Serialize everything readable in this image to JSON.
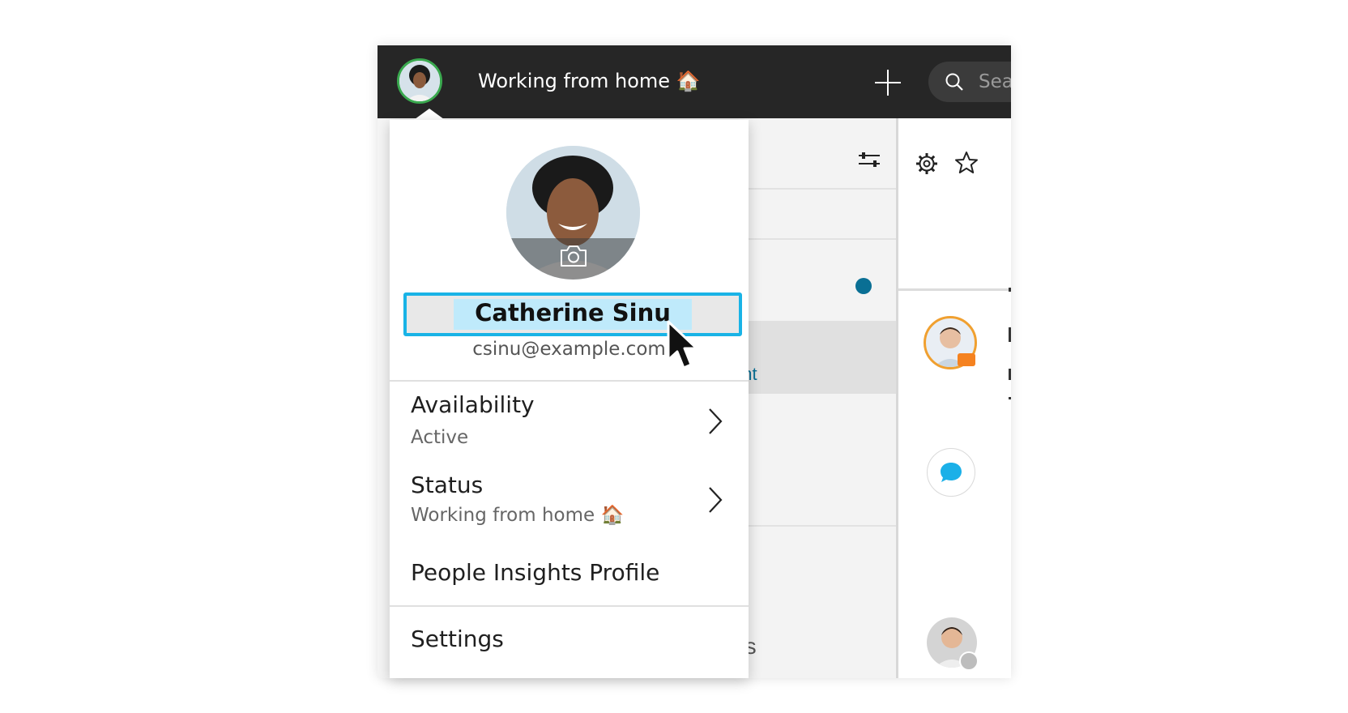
{
  "header": {
    "status_text": "Working from home 🏠",
    "search_placeholder": "Sea"
  },
  "profile": {
    "name": "Catherine Sinu",
    "email": "csinu@example.com"
  },
  "menu": {
    "availability": {
      "label": "Availability",
      "value": "Active"
    },
    "status": {
      "label": "Status",
      "value": "Working from home 🏠"
    },
    "people_insights": "People Insights Profile",
    "settings": "Settings"
  },
  "background": {
    "selected_fragment": "ent",
    "lower_fragment": "ds"
  },
  "icons": [
    "avatar",
    "plus-icon",
    "search-icon",
    "sliders-icon",
    "gear-icon",
    "star-icon",
    "camera-icon",
    "chevron-right-icon",
    "video-icon",
    "chat-icon",
    "clock-icon"
  ],
  "colors": {
    "topbar": "#262626",
    "accent_blue": "#19b3e6",
    "presence_green": "#3aa94f",
    "dot_blue": "#0a6f94",
    "video_orange": "#f58220"
  }
}
